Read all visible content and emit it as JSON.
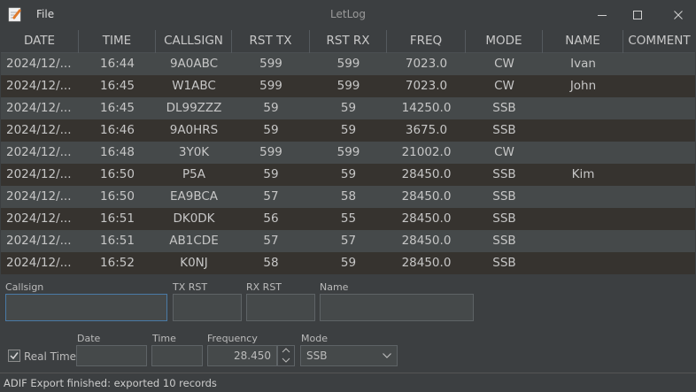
{
  "window": {
    "title": "LetLog"
  },
  "menu": {
    "file": "File"
  },
  "table": {
    "headers": [
      "DATE",
      "TIME",
      "CALLSIGN",
      "RST TX",
      "RST RX",
      "FREQ",
      "MODE",
      "NAME",
      "COMMENT"
    ],
    "rows": [
      [
        "2024/12/...",
        "16:44",
        "9A0ABC",
        "599",
        "599",
        "7023.0",
        "CW",
        "Ivan",
        ""
      ],
      [
        "2024/12/...",
        "16:45",
        "W1ABC",
        "599",
        "599",
        "7023.0",
        "CW",
        "John",
        ""
      ],
      [
        "2024/12/...",
        "16:45",
        "DL99ZZZ",
        "59",
        "59",
        "14250.0",
        "SSB",
        "",
        ""
      ],
      [
        "2024/12/...",
        "16:46",
        "9A0HRS",
        "59",
        "59",
        "3675.0",
        "SSB",
        "",
        ""
      ],
      [
        "2024/12/...",
        "16:48",
        "3Y0K",
        "599",
        "599",
        "21002.0",
        "CW",
        "",
        ""
      ],
      [
        "2024/12/...",
        "16:50",
        "P5A",
        "59",
        "59",
        "28450.0",
        "SSB",
        "Kim",
        ""
      ],
      [
        "2024/12/...",
        "16:50",
        "EA9BCA",
        "57",
        "58",
        "28450.0",
        "SSB",
        "",
        ""
      ],
      [
        "2024/12/...",
        "16:51",
        "DK0DK",
        "56",
        "55",
        "28450.0",
        "SSB",
        "",
        ""
      ],
      [
        "2024/12/...",
        "16:51",
        "AB1CDE",
        "57",
        "57",
        "28450.0",
        "SSB",
        "",
        ""
      ],
      [
        "2024/12/...",
        "16:52",
        "K0NJ",
        "58",
        "59",
        "28450.0",
        "SSB",
        "",
        ""
      ]
    ]
  },
  "form": {
    "callsign_label": "Callsign",
    "callsign_value": "",
    "txrst_label": "TX RST",
    "rxrst_label": "RX RST",
    "name_label": "Name",
    "realtime_label": "Real Time",
    "realtime_checked": true,
    "date_label": "Date",
    "time_label": "Time",
    "frequency_label": "Frequency",
    "frequency_value": "28.450",
    "mode_label": "Mode",
    "mode_value": "SSB"
  },
  "status": {
    "text": "ADIF Export finished: exported 10 records"
  }
}
